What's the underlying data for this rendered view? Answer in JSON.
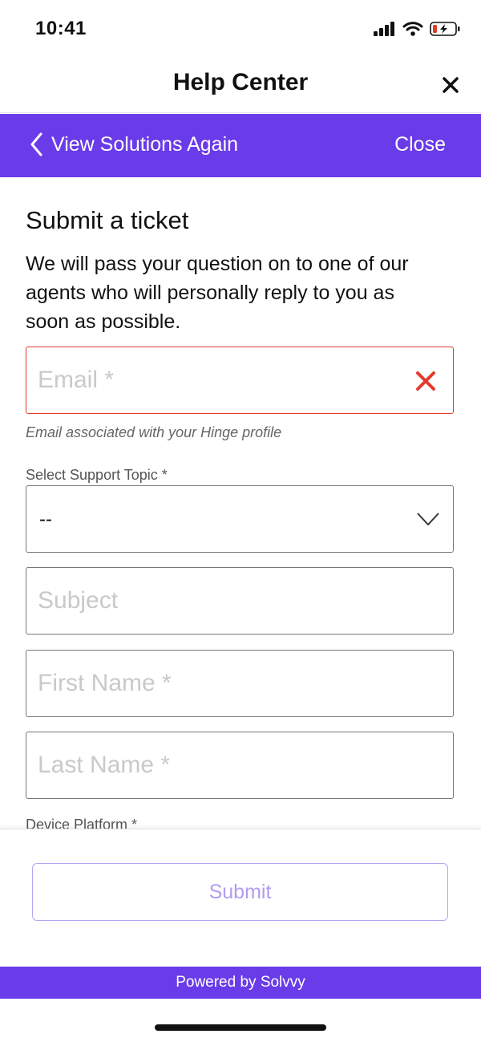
{
  "status_bar": {
    "time": "10:41",
    "icons": [
      "signal-icon",
      "wifi-icon",
      "battery-charging-icon"
    ]
  },
  "nav": {
    "title": "Help Center",
    "close_icon": "close-icon"
  },
  "header": {
    "back_label": "View Solutions Again",
    "close_label": "Close",
    "background": "#6a3be8"
  },
  "form": {
    "title": "Submit a ticket",
    "description": "We will pass your question on to one of our agents who will personally reply to you as soon as possible.",
    "email": {
      "placeholder": "Email *",
      "value": "",
      "helper": "Email associated with your Hinge profile",
      "state": "error",
      "error_color": "#e23b2e"
    },
    "topic": {
      "label": "Select Support Topic *",
      "value": "--"
    },
    "subject": {
      "placeholder": "Subject",
      "value": ""
    },
    "first_name": {
      "placeholder": "First Name *",
      "value": ""
    },
    "last_name": {
      "placeholder": "Last Name *",
      "value": ""
    },
    "device_platform": {
      "label": "Device Platform *"
    }
  },
  "footer": {
    "submit_label": "Submit",
    "powered_by": "Powered by Solvvy"
  }
}
